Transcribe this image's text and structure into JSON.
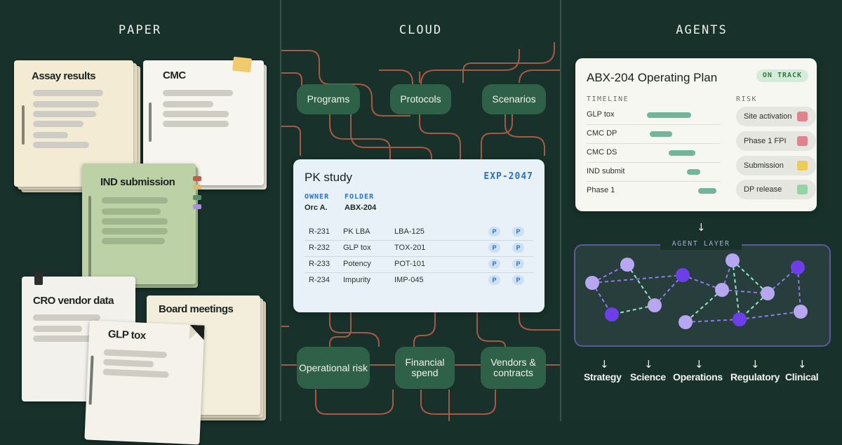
{
  "panels": {
    "paper": "PAPER",
    "cloud": "CLOUD",
    "agents": "AGENTS"
  },
  "paper_docs": {
    "assay": "Assay results",
    "cmc": "CMC",
    "ind": "IND submission",
    "cro": "CRO vendor data",
    "board": "Board meetings",
    "glp": "GLP tox"
  },
  "cloud_nodes": {
    "programs": "Programs",
    "protocols": "Protocols",
    "scenarios": "Scenarios",
    "operational_risk": "Operational risk",
    "financial_spend": "Financial spend",
    "vendors_contracts": "Vendors & contracts"
  },
  "pk_card": {
    "title": "PK study",
    "id": "EXP-2047",
    "owner_label": "OWNER",
    "owner": "Orc A.",
    "folder_label": "FOLDER",
    "folder": "ABX-204",
    "rows": [
      {
        "id": "R-231",
        "name": "PK LBA",
        "code": "LBA-125",
        "b1": "P",
        "b2": "P"
      },
      {
        "id": "R-232",
        "name": "GLP tox",
        "code": "TOX-201",
        "b1": "P",
        "b2": "P"
      },
      {
        "id": "R-233",
        "name": "Potency",
        "code": "POT-101",
        "b1": "P",
        "b2": "P"
      },
      {
        "id": "R-234",
        "name": "Impurity",
        "code": "IMP-045",
        "b1": "P",
        "b2": "P"
      }
    ]
  },
  "plan_card": {
    "title": "ABX-204 Operating Plan",
    "status": "ON TRACK",
    "timeline_label": "TIMELINE",
    "risk_label": "RISK",
    "timeline": [
      {
        "name": "GLP tox",
        "start": 0.45,
        "end": 0.78
      },
      {
        "name": "CMC DP",
        "start": 0.47,
        "end": 0.64
      },
      {
        "name": "CMC DS",
        "start": 0.61,
        "end": 0.81
      },
      {
        "name": "IND submit",
        "start": 0.75,
        "end": 0.85
      },
      {
        "name": "Phase 1",
        "start": 0.83,
        "end": 0.97
      }
    ],
    "risks": [
      {
        "name": "Site activation",
        "color": "#e0838d"
      },
      {
        "name": "Phase 1 FPI",
        "color": "#e0838d"
      },
      {
        "name": "Submission",
        "color": "#efcc5a"
      },
      {
        "name": "DP release",
        "color": "#94d3a2"
      }
    ]
  },
  "agent_layer": {
    "label": "AGENT LAYER",
    "arrow": "↓"
  },
  "departments": [
    "Strategy",
    "Science",
    "Operations",
    "Regulatory",
    "Clinical"
  ],
  "colors": {
    "background": "#18312b",
    "node": "#2f6148",
    "connector": "#c0604a",
    "agent_light": "#b7a6f0",
    "agent_dark": "#6e3ee8",
    "agent_edge": "#8fe8c4"
  }
}
